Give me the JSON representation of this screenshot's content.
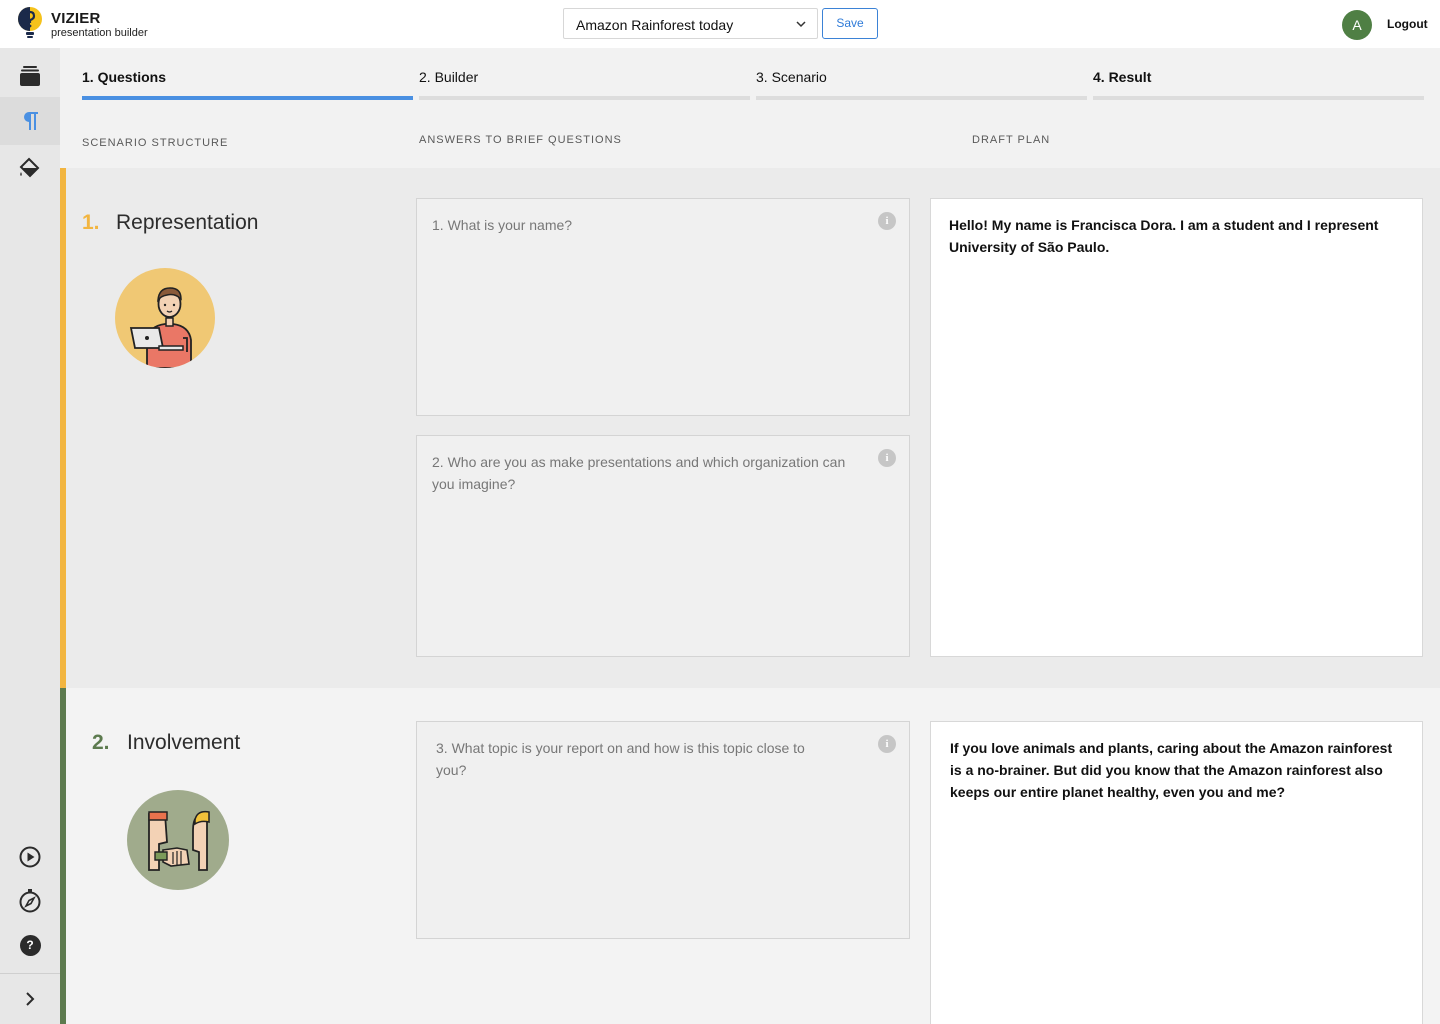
{
  "header": {
    "brand_name": "VIZIER",
    "brand_sub": "presentation builder",
    "project_select": "Amazon Rainforest today",
    "save_label": "Save",
    "avatar_initial": "A",
    "logout_label": "Logout"
  },
  "sidebar": {
    "items": [
      {
        "icon": "layers-icon"
      },
      {
        "icon": "paragraph-icon",
        "active": true
      },
      {
        "icon": "paint-bucket-icon"
      },
      {
        "icon": "play-icon"
      },
      {
        "icon": "compass-icon"
      },
      {
        "icon": "help-icon",
        "glyph": "?"
      },
      {
        "icon": "chevron-right-icon"
      }
    ]
  },
  "tabs": [
    {
      "label": "1. Questions",
      "active": true
    },
    {
      "label": "2. Builder"
    },
    {
      "label": "3. Scenario"
    },
    {
      "label": "4. Result"
    }
  ],
  "columns": {
    "structure": "SCENARIO STRUCTURE",
    "answers": "ANSWERS TO BRIEF QUESTIONS",
    "draft": "DRAFT PLAN"
  },
  "sections": [
    {
      "number": "1.",
      "title": "Representation",
      "accent": "#f2b540",
      "questions": [
        {
          "text": "1. What is your name?",
          "info": "i"
        },
        {
          "text": "2. Who are you as make presentations and which organization can you imagine?",
          "info": "i"
        }
      ],
      "draft": "Hello! My name is Francisca Dora. I am a student and I represent University of São Paulo."
    },
    {
      "number": "2.",
      "title": "Involvement",
      "accent": "#5c7a4e",
      "questions": [
        {
          "text": "3. What topic is your report on and how is this topic close to you?",
          "info": "i"
        }
      ],
      "draft": "If you love animals and plants, caring about the Amazon rainforest is a no-brainer. But did you know that the Amazon rainforest also keeps our entire planet healthy, even you and me?"
    }
  ]
}
